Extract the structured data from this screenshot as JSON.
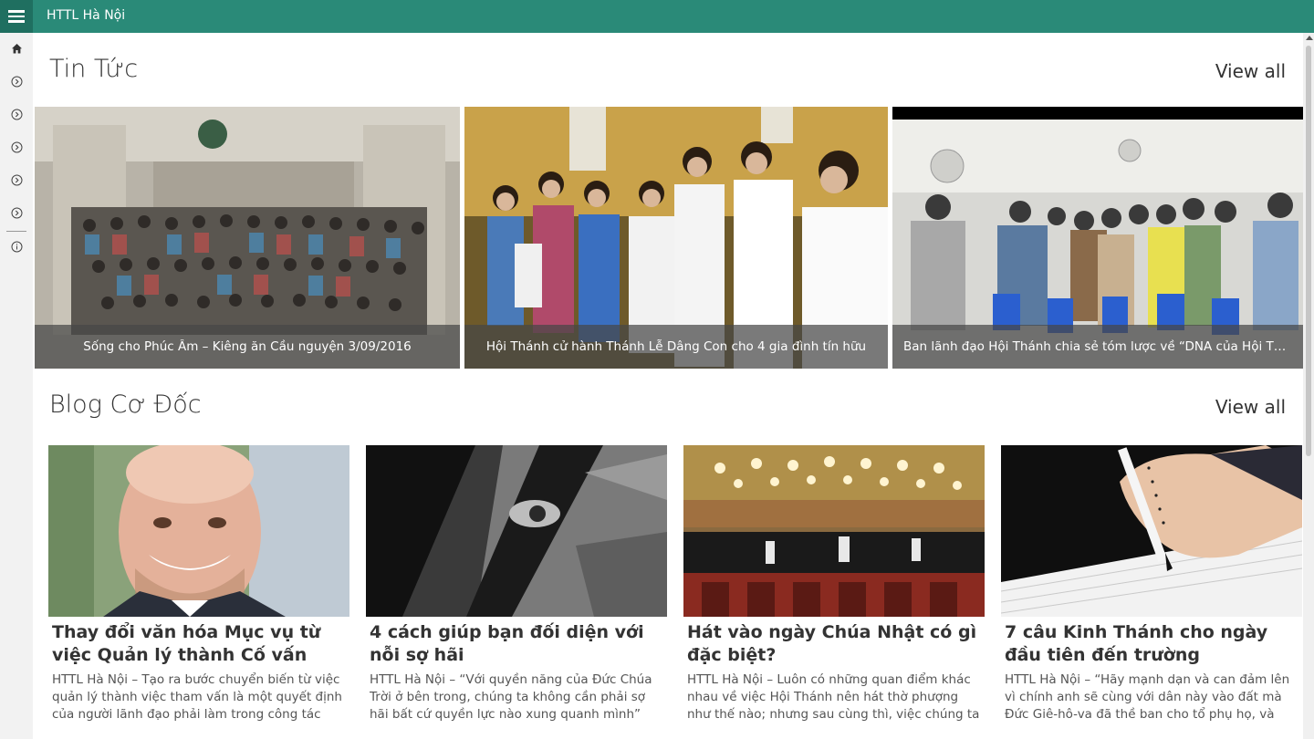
{
  "app": {
    "title": "HTTL Hà Nội"
  },
  "sidebar": {
    "icons": [
      "home-icon",
      "chevron-right-circle-icon",
      "chevron-right-circle-icon",
      "chevron-right-circle-icon",
      "chevron-right-circle-icon",
      "chevron-right-circle-icon",
      "info-icon"
    ]
  },
  "news": {
    "title": "Tin Tức",
    "view_all": "View all",
    "items": [
      {
        "caption": "Sống cho Phúc Âm – Kiêng ăn Cầu nguyện 3/09/2016"
      },
      {
        "caption": "Hội Thánh cử hành Thánh Lễ Dâng Con cho 4 gia đình tín hữu"
      },
      {
        "caption": "Ban lãnh đạo Hội Thánh chia sẻ tóm lược về “DNA của Hội Th..."
      }
    ]
  },
  "blog": {
    "title": "Blog Cơ Đốc",
    "view_all": "View all",
    "items": [
      {
        "title": "Thay đổi văn hóa Mục vụ từ việc Quản lý thành Cố vấn",
        "excerpt": "HTTL Hà Nội – Tạo ra bước chuyển biến từ việc quản lý thành việc tham vấn là một quyết định của người lãnh đạo phải làm trong công tác mục"
      },
      {
        "title": "4 cách giúp bạn đối diện với nỗi sợ hãi",
        "excerpt": "HTTL Hà Nội – “Với quyền năng của Đức Chúa Trời ở bên trong, chúng ta không cần phải sợ hãi bất cứ quyền lực nào xung quanh mình”"
      },
      {
        "title": "Hát vào ngày Chúa Nhật có gì đặc biệt?",
        "excerpt": "HTTL Hà Nội – Luôn có những quan điểm khác nhau về việc Hội Thánh nên hát thờ phượng như thế nào; nhưng sau cùng thì, việc chúng ta"
      },
      {
        "title": "7 câu Kinh Thánh cho ngày đầu tiên đến trường",
        "excerpt": "HTTL Hà Nội – “Hãy mạnh dạn và can đảm lên vì chính anh sẽ cùng với dân này vào đất mà Đức Giê-hô-va đã thề ban cho tổ phụ họ, và anh sẽ"
      }
    ]
  },
  "colors": {
    "header": "#2a8a78",
    "hamburger_bg": "#1f6f60",
    "sidebar": "#f2f2f2"
  }
}
